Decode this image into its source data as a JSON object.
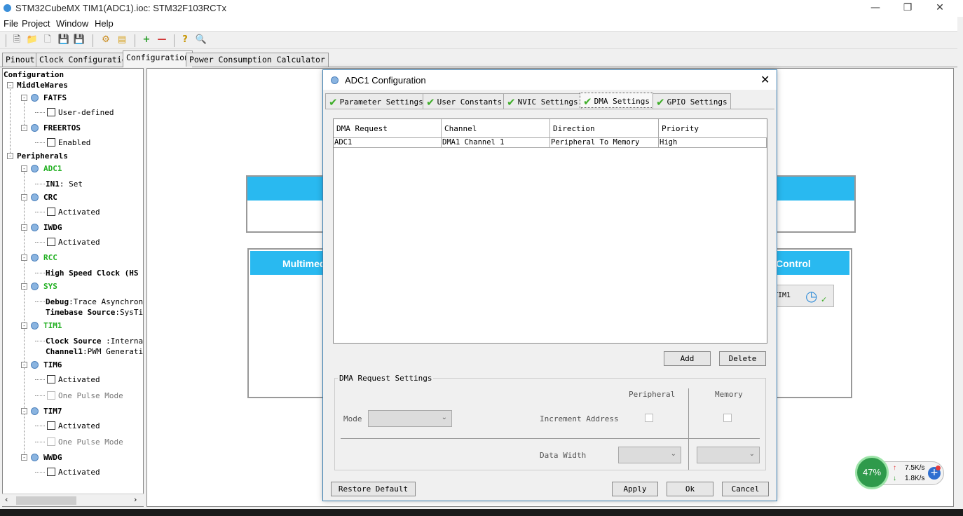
{
  "window": {
    "title": "STM32CubeMX TIM1(ADC1).ioc: STM32F103RCTx"
  },
  "menu": [
    "File",
    "Project",
    "Window",
    "Help"
  ],
  "main_tabs": [
    "Pinout",
    "Clock Configuration",
    "Configuration",
    "Power Consumption Calculator"
  ],
  "tree": {
    "root": "Configuration",
    "middlewares": "MiddleWares",
    "fatfs": "FATFS",
    "fatfs_opt": "User-defined",
    "freertos": "FREERTOS",
    "freertos_opt": "Enabled",
    "peripherals": "Peripherals",
    "adc1": "ADC1",
    "adc1_in1_b": "IN1",
    "adc1_in1_v": ": Set",
    "crc": "CRC",
    "crc_opt": "Activated",
    "iwdg": "IWDG",
    "iwdg_opt": "Activated",
    "rcc": "RCC",
    "rcc_opt": "High Speed Clock (HS",
    "sys": "SYS",
    "sys_debug_b": "Debug",
    "sys_debug_v": ":Trace Asynchrono",
    "sys_tb_b": "Timebase Source",
    "sys_tb_v": ":SysTi",
    "tim1": "TIM1",
    "tim1_clk_b": "Clock Source ",
    "tim1_clk_v": ":Interna",
    "tim1_ch_b": "Channel1",
    "tim1_ch_v": ":PWM Generatic",
    "tim6": "TIM6",
    "tim6_opt1": "Activated",
    "tim6_opt2": "One Pulse Mode",
    "tim7": "TIM7",
    "tim7_opt1": "Activated",
    "tim7_opt2": "One Pulse Mode",
    "wwdg": "WWDG",
    "wwdg_opt": "Activated"
  },
  "canvas": {
    "multimedia": "Multimed",
    "control": "Control",
    "tim_btn": "TIM1"
  },
  "dialog": {
    "title": "ADC1 Configuration",
    "tabs": [
      "Parameter Settings",
      "User Constants",
      "NVIC Settings",
      "DMA Settings",
      "GPIO Settings"
    ],
    "table": {
      "headers": [
        "DMA Request",
        "Channel",
        "Direction",
        "Priority"
      ],
      "row": [
        "ADC1",
        "DMA1 Channel 1",
        "Peripheral To Memory",
        "High"
      ]
    },
    "add": "Add",
    "delete": "Delete",
    "settings": {
      "legend": "DMA Request Settings",
      "peripheral": "Peripheral",
      "memory": "Memory",
      "mode": "Mode",
      "increment": "Increment Address",
      "data_width": "Data Width"
    },
    "restore": "Restore Default",
    "apply": "Apply",
    "ok": "Ok",
    "cancel": "Cancel"
  },
  "net": {
    "percent": "47%",
    "up": "7.5K/s",
    "down": "1.8K/s"
  }
}
